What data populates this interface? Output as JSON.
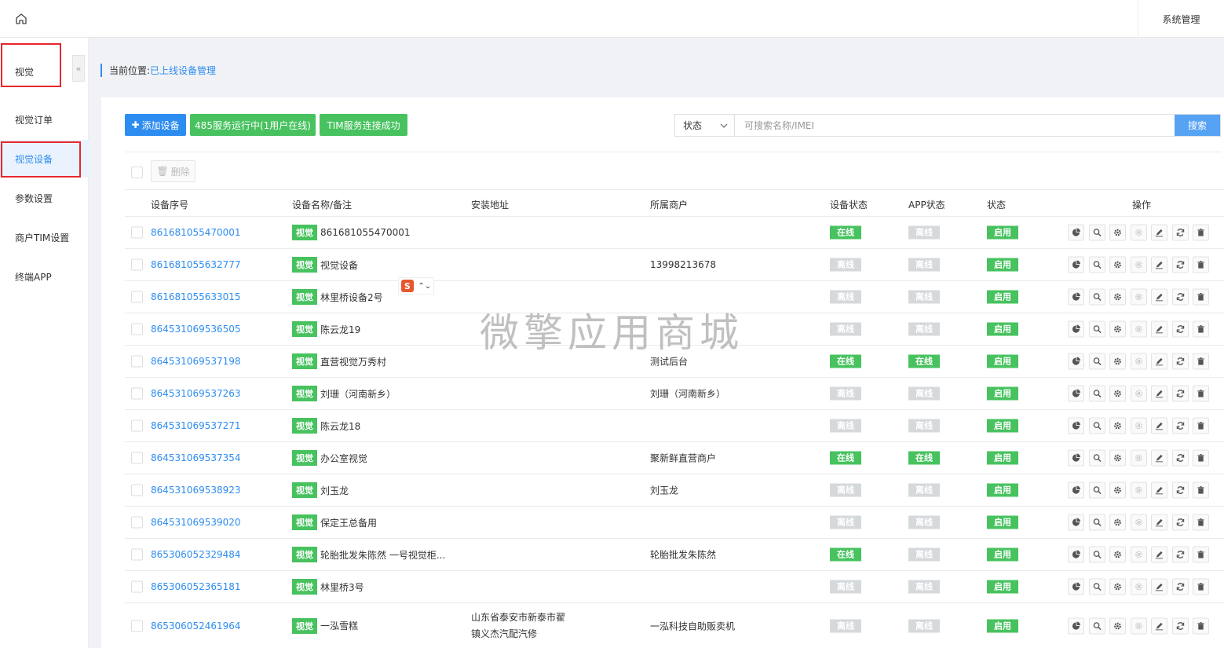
{
  "topbar": {
    "system_menu": "系统管理"
  },
  "sidebar": {
    "title": "视觉",
    "collapse": "«",
    "items": [
      {
        "label": "视觉订单",
        "active": false
      },
      {
        "label": "视觉设备",
        "active": true
      },
      {
        "label": "参数设置",
        "active": false
      },
      {
        "label": "商户TIM设置",
        "active": false
      },
      {
        "label": "终端APP",
        "active": false
      }
    ]
  },
  "breadcrumb": {
    "prefix": "当前位置:",
    "current": "已上线设备管理"
  },
  "toolbar": {
    "add_label": "添加设备",
    "service485_label": "485服务运行中(1用户在线)",
    "tim_label": "TIM服务连接成功",
    "status_select": "状态",
    "search_placeholder": "可搜索名称/IMEI",
    "search_label": "搜索",
    "delete_label": "删除"
  },
  "table": {
    "headers": {
      "serial": "设备序号",
      "name": "设备名称/备注",
      "address": "安装地址",
      "merchant": "所属商户",
      "device_status": "设备状态",
      "app_status": "APP状态",
      "status": "状态",
      "ops": "操作"
    },
    "tag": "视觉",
    "online": "在线",
    "offline": "离线",
    "enabled": "启用",
    "rows": [
      {
        "serial": "861681055470001",
        "name": "861681055470001",
        "address": "",
        "merchant": "",
        "device": "在线",
        "app": "离线",
        "status": "启用"
      },
      {
        "serial": "861681055632777",
        "name": "视觉设备",
        "address": "",
        "merchant": "13998213678",
        "device": "离线",
        "app": "离线",
        "status": "启用"
      },
      {
        "serial": "861681055633015",
        "name": "林里桥设备2号",
        "address": "",
        "merchant": "",
        "device": "离线",
        "app": "离线",
        "status": "启用"
      },
      {
        "serial": "864531069536505",
        "name": "陈云龙19",
        "address": "",
        "merchant": "",
        "device": "离线",
        "app": "离线",
        "status": "启用"
      },
      {
        "serial": "864531069537198",
        "name": "直营视觉万秀村",
        "address": "",
        "merchant": "测试后台",
        "device": "在线",
        "app": "在线",
        "status": "启用"
      },
      {
        "serial": "864531069537263",
        "name": "刘珊（河南新乡）",
        "address": "",
        "merchant": "刘珊（河南新乡）",
        "device": "离线",
        "app": "离线",
        "status": "启用"
      },
      {
        "serial": "864531069537271",
        "name": "陈云龙18",
        "address": "",
        "merchant": "",
        "device": "离线",
        "app": "离线",
        "status": "启用"
      },
      {
        "serial": "864531069537354",
        "name": "办公室视觉",
        "address": "",
        "merchant": "聚新鲜直营商户",
        "device": "在线",
        "app": "在线",
        "status": "启用"
      },
      {
        "serial": "864531069538923",
        "name": "刘玉龙",
        "address": "",
        "merchant": "刘玉龙",
        "device": "离线",
        "app": "离线",
        "status": "启用"
      },
      {
        "serial": "864531069539020",
        "name": "保定王总备用",
        "address": "",
        "merchant": "",
        "device": "离线",
        "app": "离线",
        "status": "启用"
      },
      {
        "serial": "865306052329484",
        "name": "轮胎批发朱陈然 一号视觉柜...",
        "address": "",
        "merchant": "轮胎批发朱陈然",
        "device": "在线",
        "app": "离线",
        "status": "启用"
      },
      {
        "serial": "865306052365181",
        "name": "林里桥3号",
        "address": "",
        "merchant": "",
        "device": "离线",
        "app": "离线",
        "status": "启用"
      },
      {
        "serial": "865306052461964",
        "name": "一泓雪糕",
        "address": "山东省泰安市新泰市翟镇义杰汽配汽修",
        "merchant": "一泓科技自助贩卖机",
        "device": "离线",
        "app": "离线",
        "status": "启用"
      }
    ]
  },
  "watermark": "微擎应用商城",
  "ime": {
    "logo": "S",
    "arrows": "⌃⌄"
  },
  "colors": {
    "primary": "#2d8cf0",
    "green": "#47c25f",
    "offline": "#d6d9dc",
    "highlight_box": "#e8262d"
  }
}
